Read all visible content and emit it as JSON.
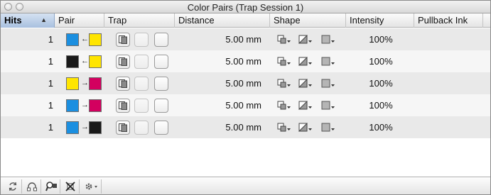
{
  "window": {
    "title": "Color Pairs (Trap Session 1)"
  },
  "columns": {
    "hits": "Hits",
    "pair": "Pair",
    "trap": "Trap",
    "distance": "Distance",
    "shape": "Shape",
    "intensity": "Intensity",
    "pullback": "Pullback Ink"
  },
  "sort": {
    "column": "Hits",
    "direction": "ascending"
  },
  "colors": {
    "cyan": "#1b8fe0",
    "yellow": "#ffe500",
    "black": "#1a1a1a",
    "magenta": "#d3005f"
  },
  "rows": [
    {
      "hits": "1",
      "pair": [
        "cyan",
        "yellow"
      ],
      "direction": "left",
      "distance": "5.00 mm",
      "intensity": "100%",
      "pullback": ""
    },
    {
      "hits": "1",
      "pair": [
        "black",
        "yellow"
      ],
      "direction": "left",
      "distance": "5.00 mm",
      "intensity": "100%",
      "pullback": ""
    },
    {
      "hits": "1",
      "pair": [
        "yellow",
        "magenta"
      ],
      "direction": "right",
      "distance": "5.00 mm",
      "intensity": "100%",
      "pullback": ""
    },
    {
      "hits": "1",
      "pair": [
        "cyan",
        "magenta"
      ],
      "direction": "right",
      "distance": "5.00 mm",
      "intensity": "100%",
      "pullback": ""
    },
    {
      "hits": "1",
      "pair": [
        "cyan",
        "black"
      ],
      "direction": "right",
      "distance": "5.00 mm",
      "intensity": "100%",
      "pullback": ""
    }
  ],
  "toolbar": {
    "buttons": [
      "refresh-icon",
      "link-pair-icon",
      "magnify-pair-icon",
      "remove-pair-icon",
      "gear-menu-icon"
    ]
  }
}
